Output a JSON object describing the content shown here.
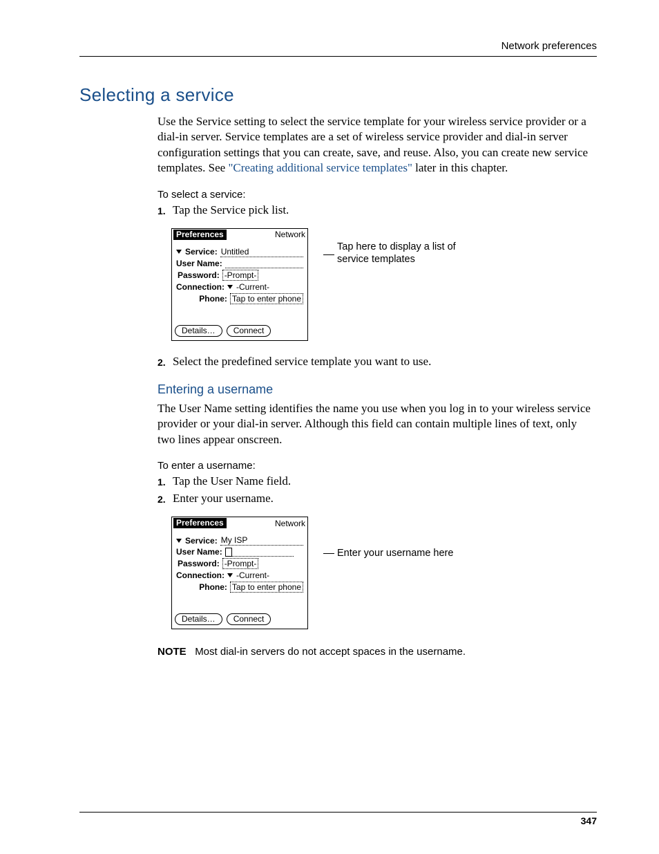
{
  "page": {
    "running_head": "Network preferences",
    "number": "347"
  },
  "h1": "Selecting a service",
  "intro": {
    "part1": "Use the Service setting to select the service template for your wireless service provider or a dial-in server. Service templates are a set of wireless service provider and dial-in server configuration settings that you can create, save, and reuse. Also, you can create new service templates. See ",
    "link": "\"Creating additional service templates\"",
    "part2": " later in this chapter."
  },
  "proc1": {
    "title": "To select a service:",
    "steps": [
      "Tap the Service pick list.",
      "Select the predefined service template you want to use."
    ]
  },
  "fig1": {
    "title": "Preferences",
    "category": "Network",
    "service_label": "Service:",
    "service_value": "Untitled",
    "username_label": "User Name:",
    "username_value": "",
    "password_label": "Password:",
    "password_value": "-Prompt-",
    "connection_label": "Connection:",
    "connection_value": "-Current-",
    "phone_label": "Phone:",
    "phone_value": "Tap to enter phone",
    "btn_details": "Details…",
    "btn_connect": "Connect",
    "callout": "Tap here to display a list of service templates"
  },
  "sec2": {
    "h2": "Entering a username",
    "body": "The User Name setting identifies the name you use when you log in to your wireless service provider or your dial-in server. Although this field can contain multiple lines of text, only two lines appear onscreen."
  },
  "proc2": {
    "title": "To enter a username:",
    "steps": [
      "Tap the User Name field.",
      "Enter your username."
    ]
  },
  "fig2": {
    "title": "Preferences",
    "category": "Network",
    "service_label": "Service:",
    "service_value": "My ISP",
    "username_label": "User Name:",
    "password_label": "Password:",
    "password_value": "-Prompt-",
    "connection_label": "Connection:",
    "connection_value": "-Current-",
    "phone_label": "Phone:",
    "phone_value": "Tap to enter phone",
    "btn_details": "Details…",
    "btn_connect": "Connect",
    "callout": "Enter your username here"
  },
  "note": {
    "label": "NOTE",
    "text": "Most dial-in servers do not accept spaces in the username."
  }
}
